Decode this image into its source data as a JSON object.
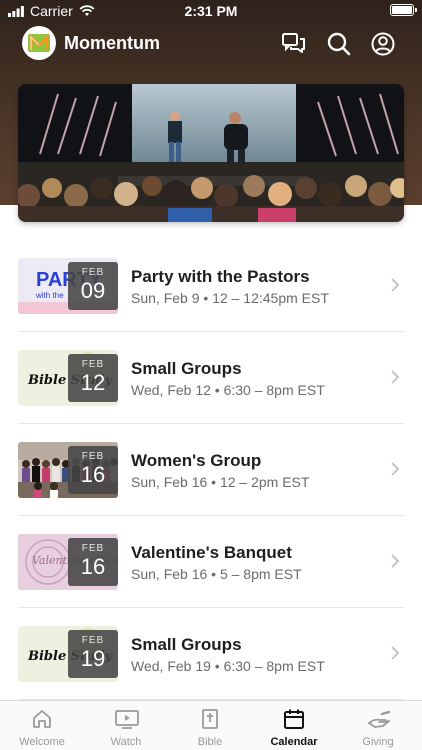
{
  "status_bar": {
    "carrier": "Carrier",
    "time": "2:31 PM"
  },
  "header": {
    "title": "Momentum",
    "logo_letter": "M"
  },
  "events": [
    {
      "month": "FEB",
      "day": "09",
      "title": "Party with the Pastors",
      "when": "Sun, Feb 9 • 12 – 12:45pm EST",
      "thumb_text": "PARTY",
      "thumb_sub": "with the"
    },
    {
      "month": "FEB",
      "day": "12",
      "title": "Small Groups",
      "when": "Wed, Feb 12 • 6:30 – 8pm EST",
      "thumb_text": "Bible Study"
    },
    {
      "month": "FEB",
      "day": "16",
      "title": "Women's Group",
      "when": "Sun, Feb 16 • 12 – 2pm EST"
    },
    {
      "month": "FEB",
      "day": "16",
      "title": "Valentine's Banquet",
      "when": "Sun, Feb 16 • 5 – 8pm EST",
      "thumb_text": "Valentine's Banq"
    },
    {
      "month": "FEB",
      "day": "19",
      "title": "Small Groups",
      "when": "Wed, Feb 19 • 6:30 – 8pm EST",
      "thumb_text": "Bible Study"
    }
  ],
  "tabs": [
    {
      "label": "Welcome",
      "icon": "home-icon"
    },
    {
      "label": "Watch",
      "icon": "tv-play-icon"
    },
    {
      "label": "Bible",
      "icon": "bible-icon"
    },
    {
      "label": "Calendar",
      "icon": "calendar-icon",
      "active": true
    },
    {
      "label": "Giving",
      "icon": "giving-hand-icon"
    }
  ],
  "colors": {
    "header_bg": "#3f2d22",
    "badge_bg": "#464646",
    "active_tab": "#111111",
    "inactive_tab": "#9a9a9a"
  }
}
